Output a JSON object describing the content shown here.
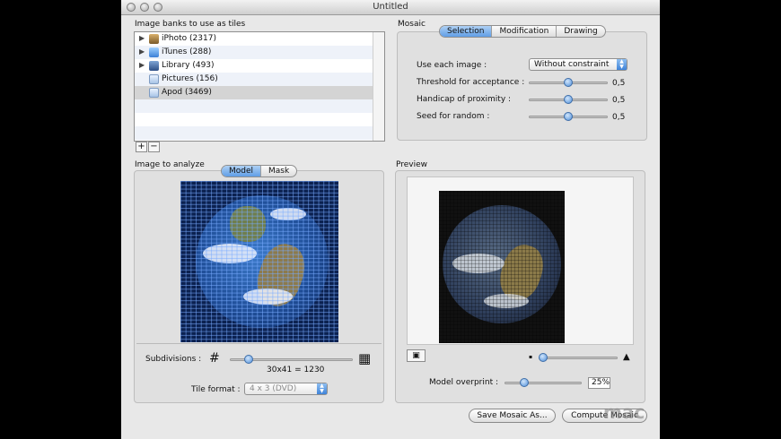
{
  "window": {
    "title": "Untitled"
  },
  "banks": {
    "heading": "Image banks to use as tiles",
    "items": [
      {
        "label": "iPhoto (2317)",
        "icon": "iphoto-icon",
        "expandable": true
      },
      {
        "label": "iTunes (288)",
        "icon": "itunes-icon",
        "expandable": true
      },
      {
        "label": "Library (493)",
        "icon": "library-icon",
        "expandable": true
      },
      {
        "label": "Pictures (156)",
        "icon": "folder-icon",
        "expandable": false
      },
      {
        "label": "Apod (3469)",
        "icon": "folder-icon",
        "expandable": false,
        "selected": true
      }
    ],
    "add_label": "+",
    "remove_label": "−"
  },
  "mosaic": {
    "heading": "Mosaic",
    "tabs": [
      "Selection",
      "Modification",
      "Drawing"
    ],
    "active_tab": "Selection",
    "use_each_label": "Use each image :",
    "use_each_value": "Without constraint",
    "threshold_label": "Threshold for acceptance :",
    "threshold_value": "0,5",
    "handicap_label": "Handicap of proximity :",
    "handicap_value": "0,5",
    "seed_label": "Seed for random :",
    "seed_value": "0,5"
  },
  "analyze": {
    "heading": "Image to analyze",
    "tabs": [
      "Model",
      "Mask"
    ],
    "active_tab": "Model",
    "subdivisions_label": "Subdivisions :",
    "subdivisions_value": "30x41 = 1230",
    "subdivisions_level": 0.15,
    "tile_format_label": "Tile format :",
    "tile_format_value": "4 x 3 (DVD)"
  },
  "preview": {
    "heading": "Preview",
    "zoom_level": 0.05,
    "overprint_label": "Model overprint :",
    "overprint_value": "25%",
    "overprint_level": 0.25
  },
  "buttons": {
    "save": "Save Mosaic As...",
    "compute": "Compute Mosaic"
  },
  "watermark": "mac"
}
